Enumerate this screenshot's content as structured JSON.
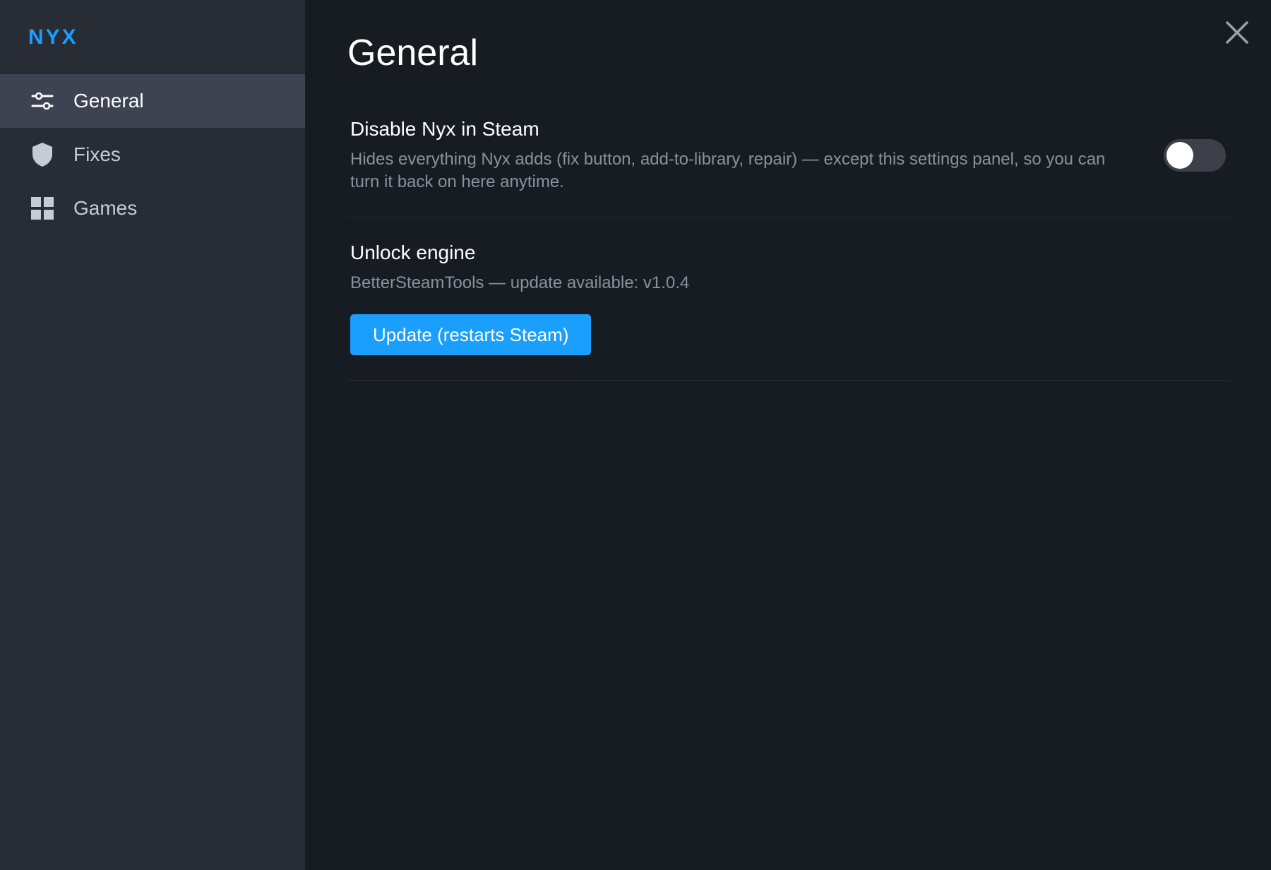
{
  "app": {
    "brand": "NYX"
  },
  "sidebar": {
    "items": [
      {
        "label": "General",
        "icon": "sliders-icon",
        "active": true
      },
      {
        "label": "Fixes",
        "icon": "shield-icon",
        "active": false
      },
      {
        "label": "Games",
        "icon": "grid-icon",
        "active": false
      }
    ]
  },
  "main": {
    "title": "General",
    "close_icon": "close-icon",
    "settings": [
      {
        "title": "Disable Nyx in Steam",
        "description": "Hides everything Nyx adds (fix button, add-to-library, repair) — except this settings panel, so you can turn it back on here anytime.",
        "toggle_on": false
      },
      {
        "title": "Unlock engine",
        "description": "BetterSteamTools — update available: v1.0.4",
        "button_label": "Update (restarts Steam)"
      }
    ]
  },
  "colors": {
    "accent": "#1a9fff",
    "sidebar_bg": "#282c34",
    "main_bg": "#171c23",
    "active_item_bg": "#3d4350"
  }
}
